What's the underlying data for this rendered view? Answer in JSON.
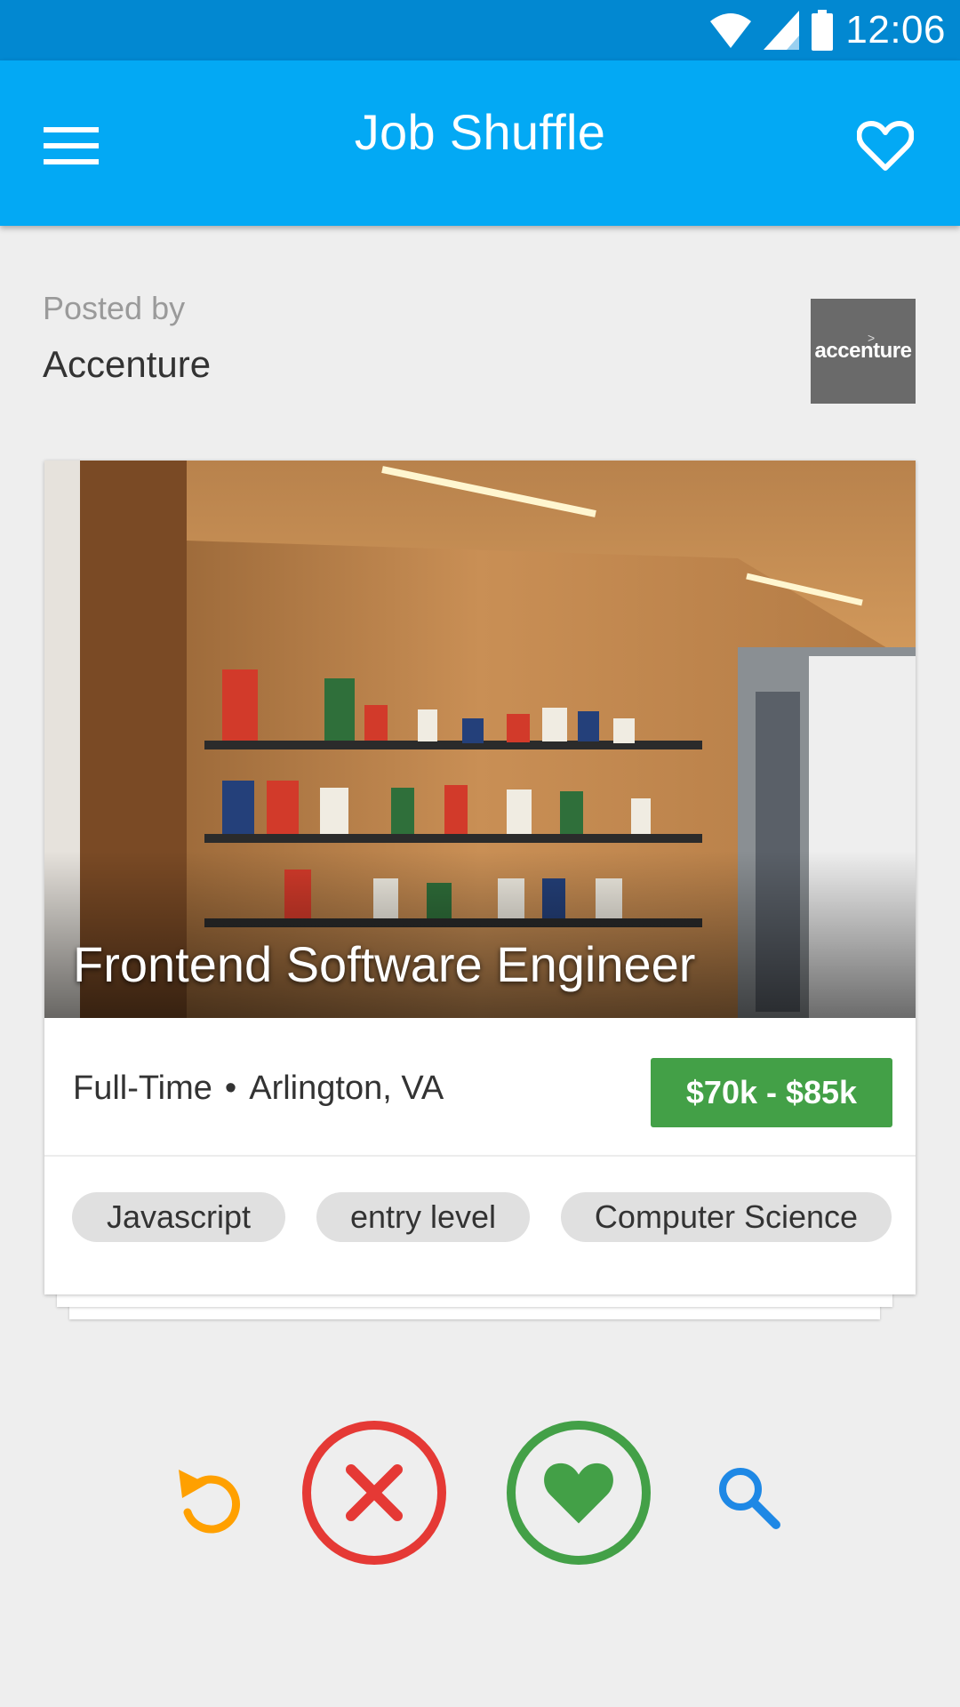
{
  "status_bar": {
    "time": "12:06",
    "icons": [
      "wifi-icon",
      "signal-icon",
      "battery-icon"
    ]
  },
  "app_bar": {
    "title": "Job Shuffle",
    "menu_icon": "menu-icon",
    "favorite_icon": "heart-outline-icon"
  },
  "poster": {
    "label": "Posted by",
    "company": "Accenture",
    "logo_text": "accenture"
  },
  "job": {
    "title": "Frontend Software Engineer",
    "type": "Full-Time",
    "separator": "•",
    "location": "Arlington, VA",
    "salary": "$70k - $85k",
    "tags": [
      "Javascript",
      "entry level",
      "Computer Science"
    ]
  },
  "actions": [
    {
      "name": "undo",
      "icon": "undo-icon",
      "color": "#ffa000"
    },
    {
      "name": "reject",
      "icon": "close-icon",
      "color": "#e53935"
    },
    {
      "name": "like",
      "icon": "heart-icon",
      "color": "#43a047"
    },
    {
      "name": "search",
      "icon": "search-icon",
      "color": "#1e88e5"
    }
  ],
  "colors": {
    "status_bar": "#0288d1",
    "app_bar": "#03a9f4",
    "salary": "#43a047",
    "background": "#eeeeee"
  }
}
